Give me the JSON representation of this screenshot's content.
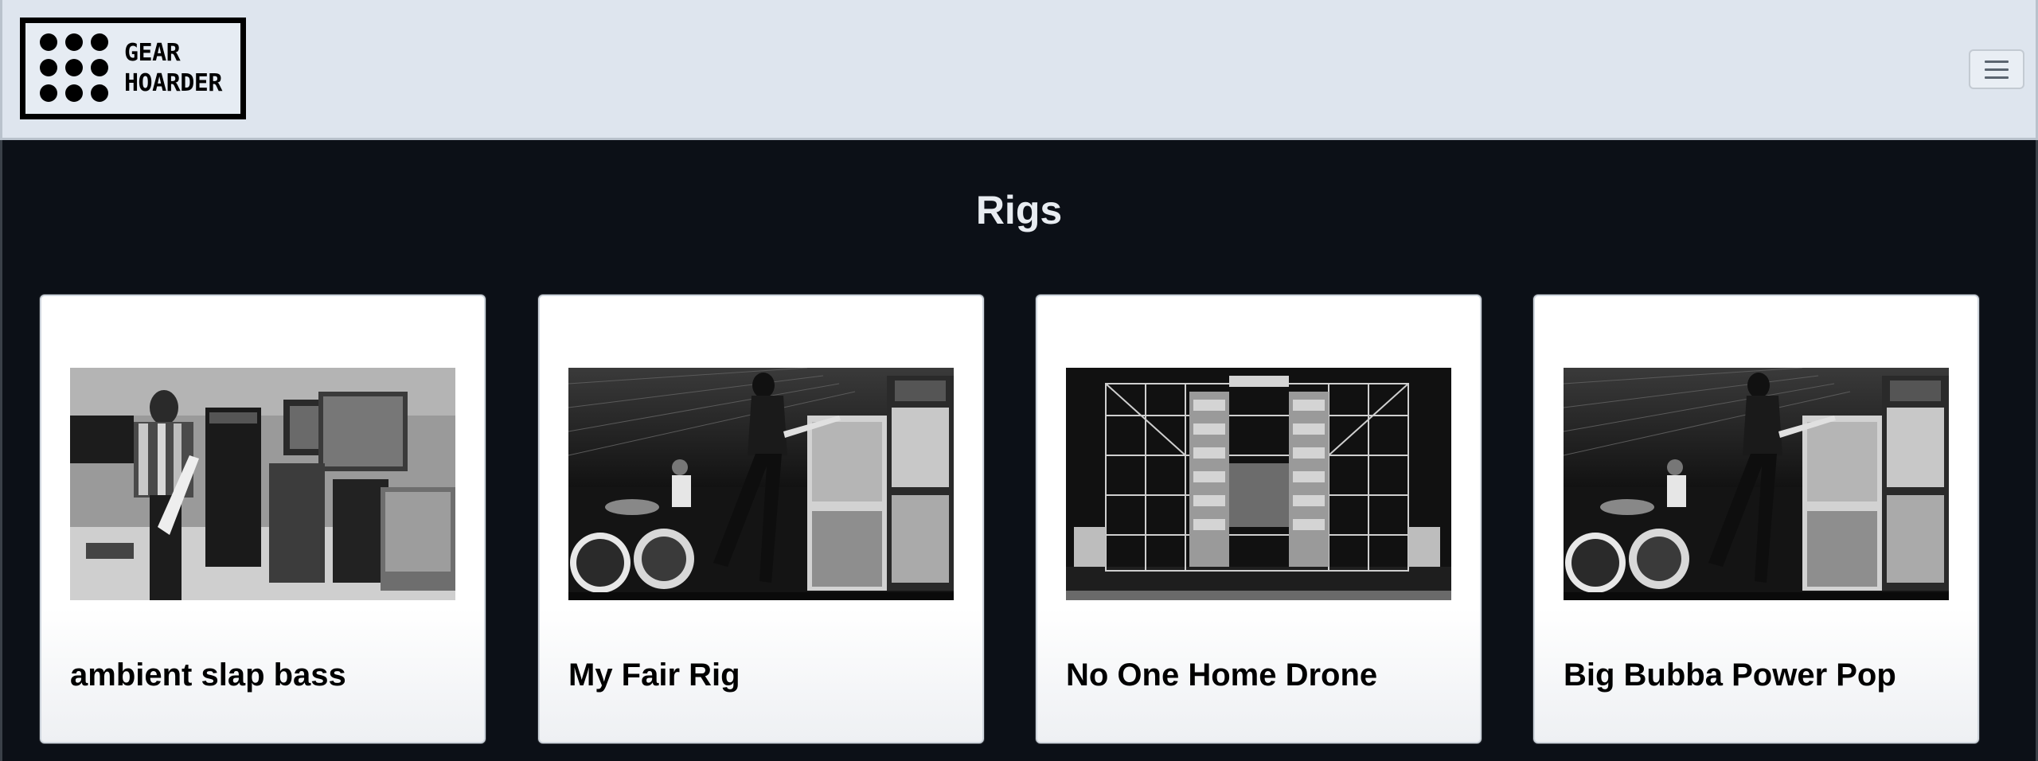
{
  "navbar": {
    "brand": {
      "line1": "GEAR",
      "line2": "HOARDER"
    },
    "toggler_icon": "hamburger-menu-icon"
  },
  "main": {
    "title": "Rigs",
    "cards": [
      {
        "title": "ambient slap bass",
        "image": "guitarist-amp-room-photo"
      },
      {
        "title": "My Fair Rig",
        "image": "guitarist-stage-amps-photo"
      },
      {
        "title": "No One Home Drone",
        "image": "wall-of-sound-stage-photo"
      },
      {
        "title": "Big Bubba Power Pop",
        "image": "guitarist-stage-amps-photo"
      }
    ]
  }
}
